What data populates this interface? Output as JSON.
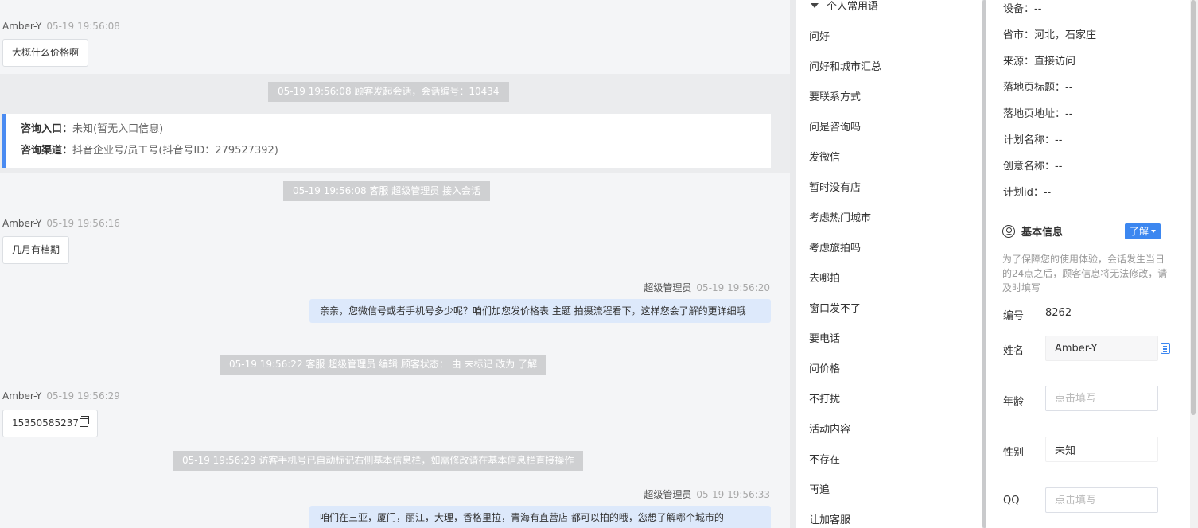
{
  "chat": {
    "messages": [
      {
        "sender": "Amber-Y",
        "time": "05-19 19:56:08",
        "text": "大概什么价格啊"
      },
      {
        "sender": "Amber-Y",
        "time": "05-19 19:56:16",
        "text": "几月有档期"
      },
      {
        "sender": "超级管理员",
        "time": "05-19 19:56:20",
        "text": "亲亲，您微信号或者手机号多少呢？咱们加您发价格表 主题 拍摄流程看下，这样您会了解的更详细哦"
      },
      {
        "sender": "Amber-Y",
        "time": "05-19 19:56:29",
        "text": "15350585237"
      },
      {
        "sender": "超级管理员",
        "time": "05-19 19:56:33",
        "text": "咱们在三亚，厦门，丽江，大理，香格里拉，青海有直营店 都可以拍的哦，您想了解哪个城市的"
      }
    ],
    "system": [
      "05-19 19:56:08 顾客发起会话，会话编号：10434",
      "05-19 19:56:08 客服 超级管理员 接入会话",
      "05-19 19:56:22 客服 超级管理员 编辑 顾客状态： 由 未标记 改为 了解",
      "05-19 19:56:29 访客手机号已自动标记右侧基本信息栏，如需修改请在基本信息栏直接操作"
    ],
    "entry": {
      "entry_label": "咨询入口：",
      "entry_value": "未知(暂无入口信息)",
      "channel_label": "咨询渠道：",
      "channel_value": "抖音企业号/员工号(抖音号ID：279527392)"
    }
  },
  "phrases": {
    "group_title": "个人常用语",
    "items": [
      "问好",
      "问好和城市汇总",
      "要联系方式",
      "问是咨询吗",
      "发微信",
      "暂时没有店",
      "考虑热门城市",
      "考虑旅拍吗",
      "去哪拍",
      "窗口发不了",
      "要电话",
      "问价格",
      "不打扰",
      "活动内容",
      "不存在",
      "再追",
      "让加客服"
    ]
  },
  "info": {
    "rows": [
      "设备：--",
      "省市：河北，石家庄",
      "来源：直接访问",
      "落地页标题：--",
      "落地页地址：--",
      "计划名称：--",
      "创意名称：--",
      "计划id：--"
    ],
    "section_title": "基本信息",
    "status_tag": "了解",
    "notice": "为了保障您的使用体验，会话发生当日的24点之后，顾客信息将无法修改，请及时填写",
    "fields": {
      "id_label": "编号",
      "id_value": "8262",
      "name_label": "姓名",
      "name_value": "Amber-Y",
      "age_label": "年龄",
      "age_placeholder": "点击填写",
      "gender_label": "性别",
      "gender_value": "未知",
      "qq_label": "QQ",
      "qq_placeholder": "点击填写"
    }
  },
  "colors": {
    "accent": "#3c87f0",
    "outgoing_bubble": "#dde9fb",
    "system_pill": "#cfd0d2",
    "entry_bar": "#4a8bf2"
  }
}
